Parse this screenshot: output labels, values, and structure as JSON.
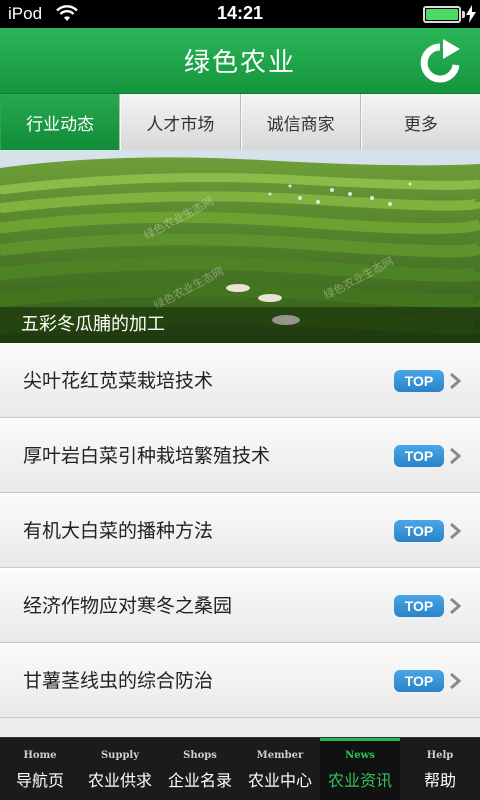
{
  "status_bar": {
    "carrier": "iPod",
    "time": "14:21",
    "battery_level": 1.0
  },
  "header": {
    "title": "绿色农业",
    "refresh_icon": "refresh-icon"
  },
  "tabs": [
    {
      "label": "行业动态",
      "active": true
    },
    {
      "label": "人才市场",
      "active": false
    },
    {
      "label": "诚信商家",
      "active": false
    },
    {
      "label": "更多",
      "active": false
    }
  ],
  "banner": {
    "caption": "五彩冬瓜脯的加工",
    "watermark": "绿色农业生态网"
  },
  "articles": [
    {
      "title": "尖叶花红苋菜栽培技术",
      "badge": "TOP"
    },
    {
      "title": "厚叶岩白菜引种栽培繁殖技术",
      "badge": "TOP"
    },
    {
      "title": "有机大白菜的播种方法",
      "badge": "TOP"
    },
    {
      "title": "经济作物应对寒冬之桑园",
      "badge": "TOP"
    },
    {
      "title": "甘薯茎线虫的综合防治",
      "badge": "TOP"
    }
  ],
  "bottom_nav": [
    {
      "en": "Home",
      "cn": "导航页",
      "active": false
    },
    {
      "en": "Supply",
      "cn": "农业供求",
      "active": false
    },
    {
      "en": "Shops",
      "cn": "企业名录",
      "active": false
    },
    {
      "en": "Member",
      "cn": "农业中心",
      "active": false
    },
    {
      "en": "News",
      "cn": "农业资讯",
      "active": true
    },
    {
      "en": "Help",
      "cn": "帮助",
      "active": false
    }
  ],
  "colors": {
    "brand_green": "#1ea64a",
    "badge_blue": "#2f8fd6",
    "active_nav": "#2fc15a"
  }
}
